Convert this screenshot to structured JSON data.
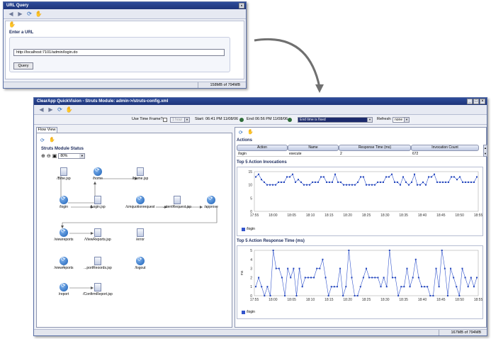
{
  "url_window": {
    "title": "URL Query",
    "enter_url_label": "Enter a URL",
    "url_value": "http://localhost:7101/admin/login.do",
    "query_button": "Query",
    "memory": "158MB of 794MB"
  },
  "main_window": {
    "title": "ClearApp QuickVision - Struts Module: admin->/struts-config.xml",
    "use_time_frame_label": "Use Time Frame?",
    "time_frame_value": "1 hour",
    "start_label": "Start:",
    "start_value": "06:41 PM 11/08/06",
    "end_label": "End:",
    "end_value": "06:56 PM 11/08/06",
    "end_mode_value": "End time is fixed",
    "refresh_label": "Refresh:",
    "refresh_value": "none",
    "memory": "167MB of 794MB"
  },
  "flow_view": {
    "tab_label": "Flow View",
    "title": "Struts Module Status",
    "zoom_value": "80%",
    "nodes": [
      {
        "id": "n1",
        "label": "/Bme.jsp",
        "kind": "page"
      },
      {
        "id": "n2",
        "label": "/home",
        "kind": "action"
      },
      {
        "id": "n3",
        "label": "/Home.jsp",
        "kind": "page"
      },
      {
        "id": "n4",
        "label": "/login",
        "kind": "action"
      },
      {
        "id": "n5",
        "label": "/Login.jsp",
        "kind": "page"
      },
      {
        "id": "n6",
        "label": "/cmquotionrequest",
        "kind": "action"
      },
      {
        "id": "n7",
        "label": "...tientRequest.jsp",
        "kind": "page"
      },
      {
        "id": "n8",
        "label": "/approve",
        "kind": "action"
      },
      {
        "id": "n9",
        "label": "/viewreports",
        "kind": "action"
      },
      {
        "id": "n10",
        "label": "/ViewReports.jsp",
        "kind": "page"
      },
      {
        "id": "n11",
        "label": "/error",
        "kind": "page"
      },
      {
        "id": "n12",
        "label": "/viewreports",
        "kind": "action"
      },
      {
        "id": "n13",
        "label": "...portReoords.jsp",
        "kind": "page"
      },
      {
        "id": "n14",
        "label": "/logout",
        "kind": "action"
      },
      {
        "id": "n15",
        "label": "/report",
        "kind": "action"
      },
      {
        "id": "n16",
        "label": "/ConfirmReport.jsp",
        "kind": "page"
      }
    ]
  },
  "actions": {
    "label": "Actions",
    "columns": [
      "Action",
      "Name",
      "Response Time (ms)",
      "Invocation Count"
    ],
    "rows": [
      {
        "action": "/login",
        "name": "execute",
        "response": "2",
        "count": "672"
      }
    ]
  },
  "chart_data": [
    {
      "type": "line",
      "title": "Top 5 Action Invocations",
      "xlabel": "",
      "ylabel": "",
      "x": [
        "17:55",
        "18:00",
        "18:05",
        "18:10",
        "18:15",
        "18:20",
        "18:25",
        "18:30",
        "18:35",
        "18:40",
        "18:45",
        "18:50",
        "18:55"
      ],
      "ylim": [
        0,
        15
      ],
      "yticks": [
        0,
        5,
        10,
        15
      ],
      "series": [
        {
          "name": "/login",
          "values": [
            13,
            14,
            12,
            11,
            10,
            10,
            10,
            10,
            11,
            11,
            11,
            13,
            13,
            14,
            11,
            12,
            11,
            10,
            10,
            10,
            11,
            11,
            11,
            13,
            13,
            11,
            11,
            11,
            14,
            11,
            11,
            10,
            10,
            10,
            10,
            10,
            11,
            13,
            13,
            10,
            10,
            10,
            10,
            11,
            11,
            11,
            13,
            13,
            14,
            11,
            11,
            10,
            13,
            11,
            10,
            11,
            14,
            10,
            10,
            11,
            10,
            13,
            13,
            14,
            11,
            11,
            11,
            11,
            11,
            13,
            13,
            12,
            13,
            11,
            11,
            11,
            11,
            11,
            13
          ]
        }
      ]
    },
    {
      "type": "line",
      "title": "Top 5 Action Response Time (ms)",
      "xlabel": "",
      "ylabel": "ms",
      "x": [
        "17:55",
        "18:00",
        "18:05",
        "18:10",
        "18:15",
        "18:20",
        "18:25",
        "18:30",
        "18:35",
        "18:40",
        "18:45",
        "18:50",
        "18:55"
      ],
      "ylim": [
        0,
        5
      ],
      "yticks": [
        0,
        1,
        2,
        3,
        4,
        5
      ],
      "series": [
        {
          "name": "/login",
          "values": [
            1,
            2,
            1,
            0,
            1,
            0,
            5,
            3,
            3,
            2,
            0,
            3,
            2,
            3,
            0,
            3,
            1,
            2,
            2,
            2,
            2,
            3,
            3,
            4,
            2,
            0,
            1,
            1,
            1,
            3,
            0,
            1,
            5,
            2,
            0,
            0,
            1,
            2,
            3,
            2,
            2,
            2,
            2,
            1,
            2,
            1,
            5,
            2,
            2,
            0,
            1,
            1,
            3,
            1,
            2,
            4,
            2,
            1,
            1,
            1,
            0,
            0,
            3,
            1,
            5,
            3,
            0,
            3,
            2,
            1,
            0,
            3,
            2,
            1,
            2,
            1,
            2
          ]
        }
      ]
    }
  ]
}
